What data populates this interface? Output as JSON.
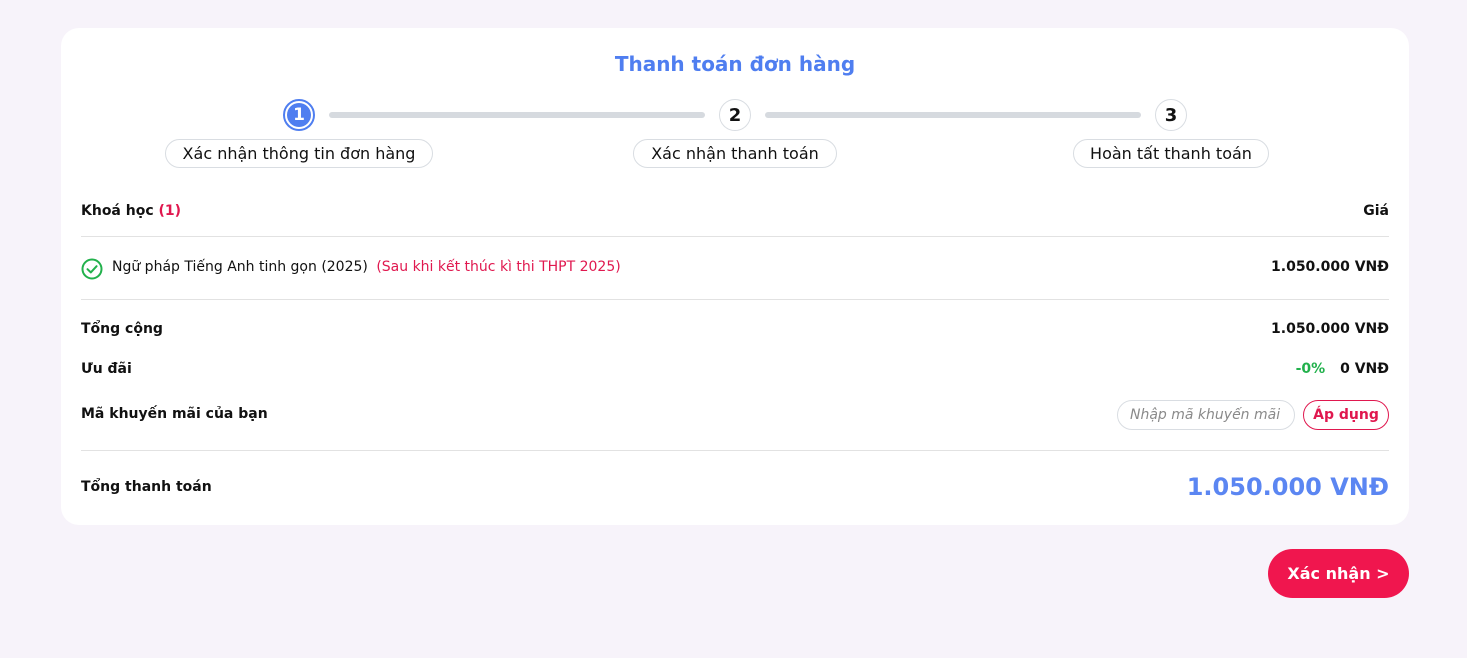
{
  "page": {
    "title": "Thanh toán đơn hàng"
  },
  "stepper": {
    "steps": [
      {
        "number": "1",
        "label": "Xác nhận thông tin đơn hàng",
        "state": "active"
      },
      {
        "number": "2",
        "label": "Xác nhận thanh toán",
        "state": "pending"
      },
      {
        "number": "3",
        "label": "Hoàn tất thanh toán",
        "state": "pending"
      }
    ]
  },
  "order": {
    "course_header": "Khoá học",
    "course_count": "(1)",
    "price_header": "Giá",
    "items": [
      {
        "icon": "check-circle-icon",
        "name": "Ngữ pháp Tiếng Anh tinh gọn (2025)",
        "note": "(Sau khi kết thúc kì thi THPT 2025)",
        "price": "1.050.000 VNĐ"
      }
    ]
  },
  "summary": {
    "subtotal_label": "Tổng cộng",
    "subtotal_value": "1.050.000 VNĐ",
    "discount_label": "Ưu đãi",
    "discount_percent": "-0%",
    "discount_value": "0 VNĐ",
    "promo_label": "Mã khuyến mãi của bạn",
    "promo_placeholder": "Nhập mã khuyến mãi",
    "promo_value": "",
    "apply_label": "Áp dụng",
    "total_label": "Tổng thanh toán",
    "total_value": "1.050.000 VNĐ"
  },
  "actions": {
    "confirm_label": "Xác nhận >"
  },
  "colors": {
    "accent_blue": "#4f7ef0",
    "accent_pink": "#e0184f",
    "success_green": "#22b14c",
    "background": "#f7f3fa"
  }
}
